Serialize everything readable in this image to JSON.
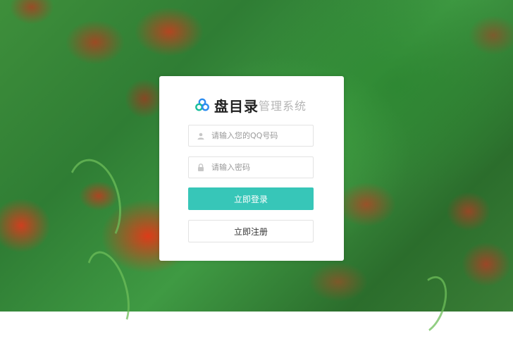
{
  "brand": {
    "name": "盘目录",
    "subtitle": "管理系统"
  },
  "form": {
    "qq_placeholder": "请输入您的QQ号码",
    "password_placeholder": "请输入密码",
    "qq_value": "",
    "password_value": "",
    "login_label": "立即登录",
    "register_label": "立即注册"
  },
  "icons": {
    "logo": "logo-icon",
    "user": "user-icon",
    "lock": "lock-icon"
  },
  "colors": {
    "primary": "#37c6b8",
    "logo_blue": "#2d8cf0",
    "logo_green": "#19be9b",
    "card_bg": "#ffffff"
  }
}
